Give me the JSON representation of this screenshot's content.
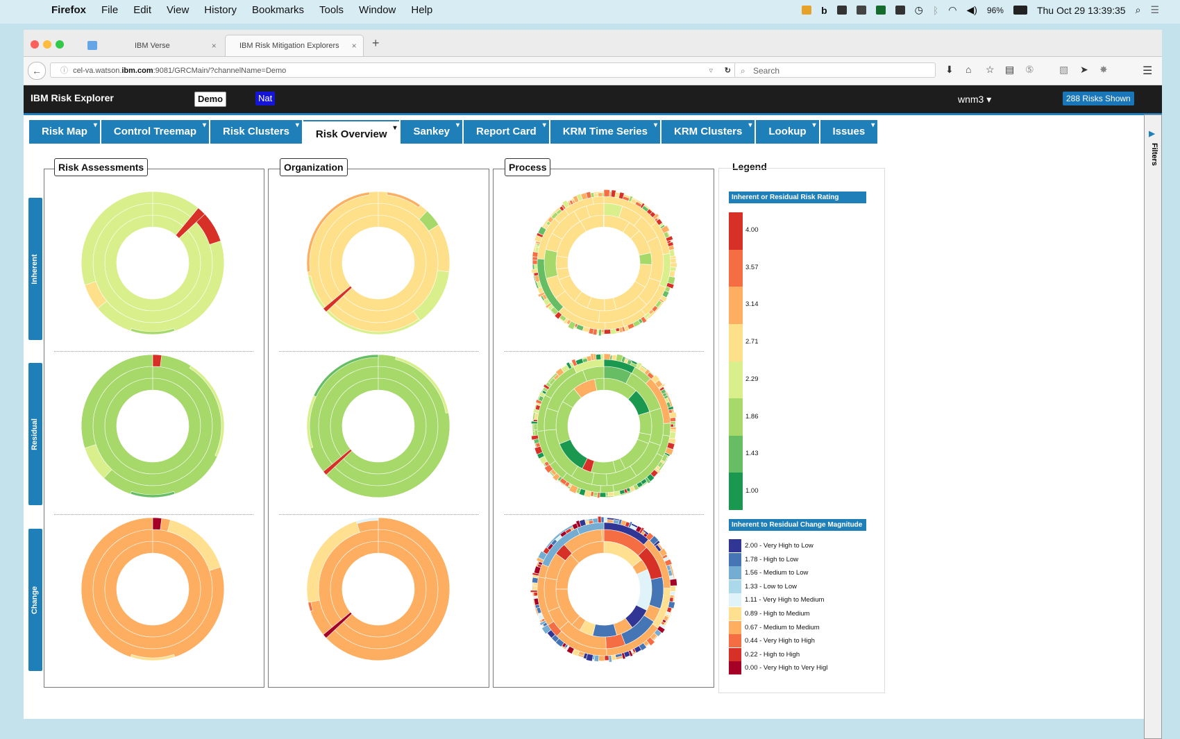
{
  "macos": {
    "apple": "",
    "app_name": "Firefox",
    "menu": [
      "File",
      "Edit",
      "View",
      "History",
      "Bookmarks",
      "Tools",
      "Window",
      "Help"
    ],
    "battery": "96%",
    "datetime": "Thu Oct 29  13:39:35"
  },
  "browser": {
    "tabs": [
      {
        "label": "IBM Verse",
        "close": "×"
      },
      {
        "label": "IBM Risk Mitigation Explorers",
        "close": "×"
      }
    ],
    "new_tab": "+",
    "url_prefix": "cel-va.watson.",
    "url_domain": "ibm.com",
    "url_suffix": ":9081/GRCMain/?channelName=Demo",
    "search_placeholder": "Search"
  },
  "app": {
    "title": "IBM Risk Explorer",
    "demo_badge": "Demo",
    "nat_badge": "Nat",
    "user": "wnm3",
    "risks_shown": "288 Risks Shown",
    "filters_label": "Filters",
    "nav_tabs": [
      "Risk Map",
      "Control Treemap",
      "Risk Clusters",
      "Risk Overview",
      "Sankey",
      "Report Card",
      "KRM Time Series",
      "KRM Clusters",
      "Lookup",
      "Issues"
    ],
    "active_tab": "Risk Overview",
    "row_labels": [
      "Inherent",
      "Residual",
      "Change"
    ],
    "columns": [
      "Risk Assessments",
      "Organization",
      "Process"
    ]
  },
  "legend": {
    "title": "Legend",
    "rating_header": "Inherent or Residual Risk Rating",
    "rating_ticks": [
      "4.00",
      "3.57",
      "3.14",
      "2.71",
      "2.29",
      "1.86",
      "1.43",
      "1.00"
    ],
    "rating_colors": [
      "#d73027",
      "#f46d43",
      "#fdae61",
      "#fee08b",
      "#d9ef8b",
      "#a6d96a",
      "#66bd63",
      "#1a9850"
    ],
    "change_header": "Inherent to Residual Change Magnitude",
    "change_items": [
      {
        "label": "2.00 - Very High to Low",
        "color": "#313695"
      },
      {
        "label": "1.78 - High to Low",
        "color": "#4575b4"
      },
      {
        "label": "1.56 - Medium to Low",
        "color": "#74add1"
      },
      {
        "label": "1.33 - Low to Low",
        "color": "#abd9e9"
      },
      {
        "label": "1.11 - Very High to Medium",
        "color": "#e0f3f8"
      },
      {
        "label": "0.89 - High to Medium",
        "color": "#fee090"
      },
      {
        "label": "0.67 - Medium to Medium",
        "color": "#fdae61"
      },
      {
        "label": "0.44 - Very High to High",
        "color": "#f46d43"
      },
      {
        "label": "0.22 - High to High",
        "color": "#d73027"
      },
      {
        "label": "0.00 - Very High to Very Higl",
        "color": "#a50026"
      }
    ]
  }
}
